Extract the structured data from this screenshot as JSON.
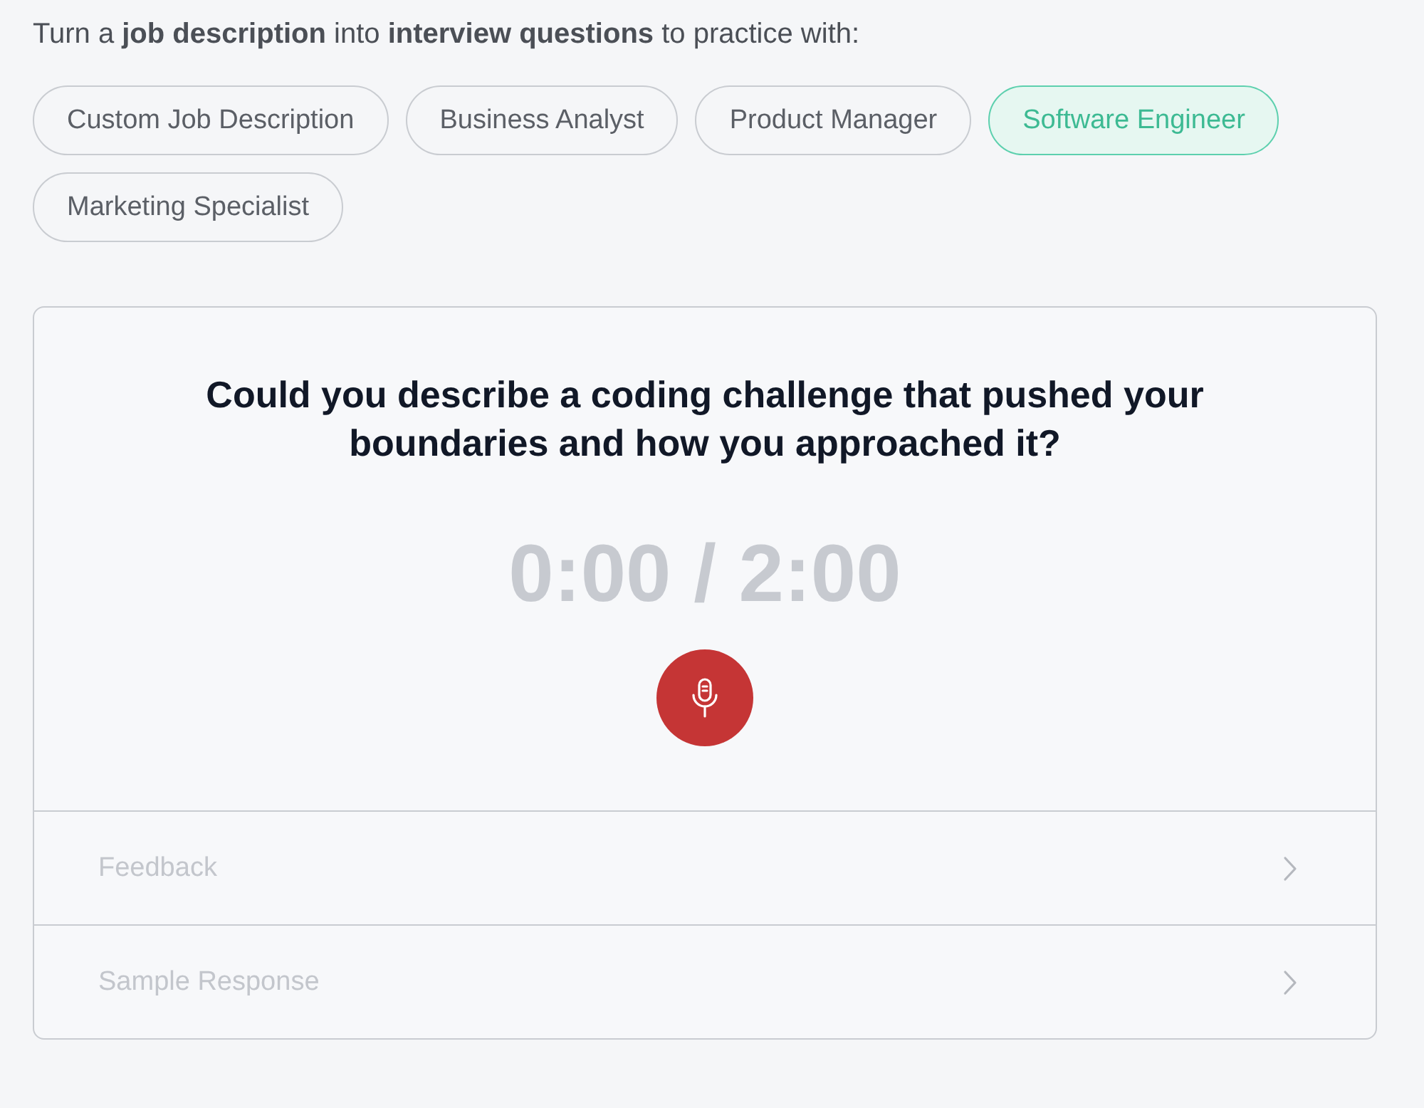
{
  "intro": "Turn a **job description** into **interview questions** to practice with:",
  "chips": [
    {
      "label": "Custom Job Description",
      "selected": false
    },
    {
      "label": "Business Analyst",
      "selected": false
    },
    {
      "label": "Product Manager",
      "selected": false
    },
    {
      "label": "Software Engineer",
      "selected": true
    },
    {
      "label": "Marketing Specialist",
      "selected": false
    }
  ],
  "card": {
    "question": "Could you describe a coding challenge that pushed your boundaries and how you approached it?",
    "timer": "0:00 / 2:00",
    "sections": [
      {
        "label": "Feedback",
        "disabled": true
      },
      {
        "label": "Sample Response",
        "disabled": true
      }
    ]
  }
}
